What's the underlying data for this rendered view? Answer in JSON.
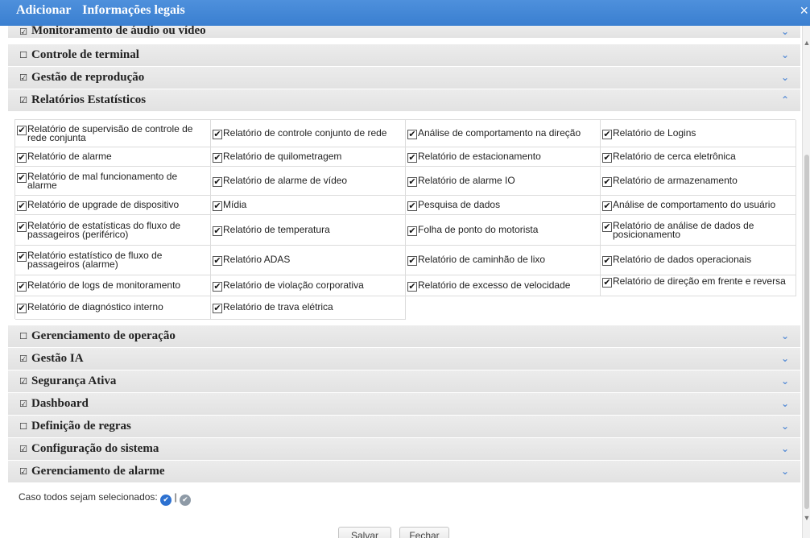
{
  "header": {
    "title_add": "Adicionar",
    "title_legal": "Informações legais",
    "close_glyph": "×"
  },
  "colors": {
    "header_bg": "#3a7fd0",
    "section_bg": "#e6e6e6",
    "accent": "#5b8fd6",
    "primary_check": "#2d71d0",
    "secondary_check": "#8e9aa6"
  },
  "sections_top": [
    {
      "label": "Monitoramento de áudio ou vídeo",
      "checked": true,
      "expanded": false
    },
    {
      "label": "Controle de terminal",
      "checked": false,
      "expanded": false
    },
    {
      "label": "Gestão de reprodução",
      "checked": true,
      "expanded": false
    },
    {
      "label": "Relatórios Estatísticos",
      "checked": true,
      "expanded": true
    }
  ],
  "reports": [
    {
      "label": "Relatório de supervisão de controle de rede conjunta",
      "checked": true
    },
    {
      "label": "Relatório de controle conjunto de rede",
      "checked": true
    },
    {
      "label": "Análise de comportamento na direção",
      "checked": true
    },
    {
      "label": "Relatório de Logins",
      "checked": true
    },
    {
      "label": "Relatório de alarme",
      "checked": true
    },
    {
      "label": "Relatório de quilometragem",
      "checked": true
    },
    {
      "label": "Relatório de estacionamento",
      "checked": true
    },
    {
      "label": "Relatório de cerca eletrônica",
      "checked": true
    },
    {
      "label": "Relatório de mal funcionamento de alarme",
      "checked": true
    },
    {
      "label": "Relatório de alarme de vídeo",
      "checked": true
    },
    {
      "label": "Relatório de alarme IO",
      "checked": true
    },
    {
      "label": "Relatório de armazenamento",
      "checked": true
    },
    {
      "label": "Relatório de upgrade de dispositivo",
      "checked": true
    },
    {
      "label": "Mídia",
      "checked": true
    },
    {
      "label": "Pesquisa de dados",
      "checked": true
    },
    {
      "label": "Análise de comportamento do usuário",
      "checked": true
    },
    {
      "label": "Relatório de estatísticas do fluxo de passageiros (periférico)",
      "checked": true
    },
    {
      "label": "Relatório de temperatura",
      "checked": true
    },
    {
      "label": "Folha de ponto do motorista",
      "checked": true
    },
    {
      "label": "Relatório de análise de dados de posicionamento",
      "checked": true
    },
    {
      "label": "Relatório estatístico de fluxo de passageiros (alarme)",
      "checked": true
    },
    {
      "label": "Relatório ADAS",
      "checked": true
    },
    {
      "label": "Relatório de caminhão de lixo",
      "checked": true
    },
    {
      "label": "Relatório de dados operacionais",
      "checked": true
    },
    {
      "label": "Relatório de logs de monitoramento",
      "checked": true
    },
    {
      "label": "Relatório de violação corporativa",
      "checked": true
    },
    {
      "label": "Relatório de excesso de velocidade",
      "checked": true
    },
    {
      "label": "Relatório de direção em frente e reversa",
      "checked": true
    },
    {
      "label": "Relatório de diagnóstico interno",
      "checked": true
    },
    {
      "label": "Relatório de trava elétrica",
      "checked": true
    }
  ],
  "sections_bottom": [
    {
      "label": "Gerenciamento de operação",
      "checked": false,
      "expanded": false
    },
    {
      "label": "Gestão IA",
      "checked": true,
      "expanded": false
    },
    {
      "label": "Segurança Ativa",
      "checked": true,
      "expanded": false
    },
    {
      "label": "Dashboard",
      "checked": true,
      "expanded": false
    },
    {
      "label": "Definição de regras",
      "checked": false,
      "expanded": false
    },
    {
      "label": "Configuração do sistema",
      "checked": true,
      "expanded": false
    },
    {
      "label": "Gerenciamento de alarme",
      "checked": true,
      "expanded": false
    }
  ],
  "footer": {
    "select_all_note": "Caso todos sejam selecionados:",
    "separator": "|",
    "save_label": "Salvar",
    "close_label": "Fechar"
  },
  "glyphs": {
    "check": "✔",
    "box_checked": "☑",
    "box_unchecked": "☐",
    "chevron_down": "⌄",
    "chevron_up": "⌃"
  }
}
